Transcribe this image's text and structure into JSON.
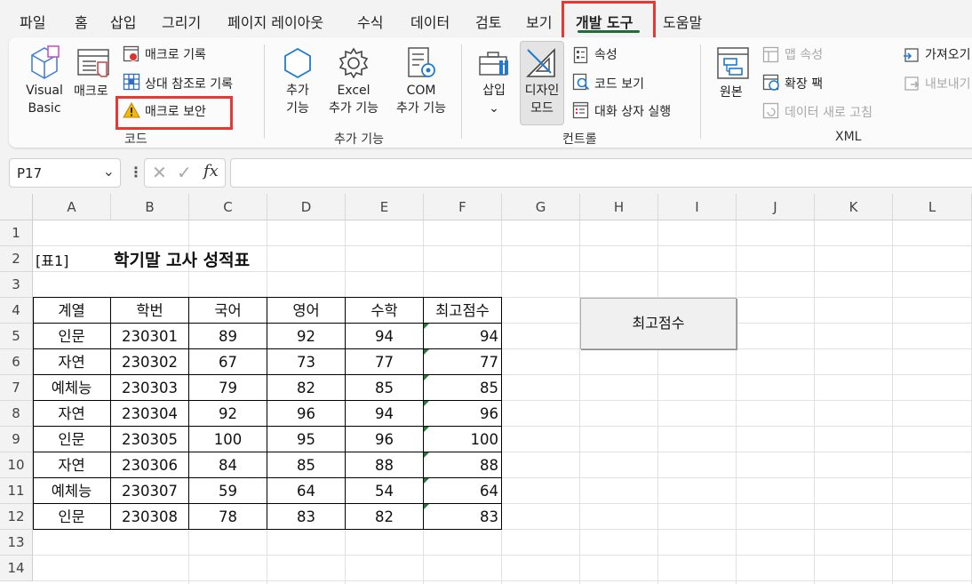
{
  "menu": [
    "파일",
    "홈",
    "삽입",
    "그리기",
    "페이지 레이아웃",
    "수식",
    "데이터",
    "검토",
    "보기",
    "개발 도구",
    "도움말"
  ],
  "menu_active_index": 9,
  "ribbon": {
    "code": {
      "visual_basic": [
        "Visual",
        "Basic"
      ],
      "macro": "매크로",
      "record_macro": "매크로 기록",
      "relative_ref": "상대 참조로 기록",
      "macro_security": "매크로 보안",
      "group_label": "코드"
    },
    "addins": {
      "addins": [
        "추가",
        "기능"
      ],
      "excel_addins": [
        "Excel",
        "추가 기능"
      ],
      "com_addins": [
        "COM",
        "추가 기능"
      ],
      "group_label": "추가 기능"
    },
    "controls": {
      "insert": "삽입",
      "design_mode": [
        "디자인",
        "모드"
      ],
      "properties": "속성",
      "view_code": "코드 보기",
      "run_dialog": "대화 상자 실행",
      "group_label": "컨트롤"
    },
    "xml": {
      "source": "원본",
      "map_properties": "맵 속성",
      "expansion_packs": "확장 팩",
      "refresh_data": "데이터 새로 고침",
      "import": "가져오기",
      "export": "내보내기",
      "group_label": "XML"
    }
  },
  "formula_bar": {
    "name_box": "P17",
    "formula": ""
  },
  "columns": [
    "A",
    "B",
    "C",
    "D",
    "E",
    "F",
    "G",
    "H",
    "I",
    "J",
    "K",
    "L"
  ],
  "rows": [
    "1",
    "2",
    "3",
    "4",
    "5",
    "6",
    "7",
    "8",
    "9",
    "10",
    "11",
    "12",
    "13",
    "14"
  ],
  "sheet": {
    "table_tag": "[표1]",
    "title": "학기말 고사 성적표",
    "headers": [
      "계열",
      "학번",
      "국어",
      "영어",
      "수학",
      "최고점수"
    ],
    "data": [
      [
        "인문",
        "230301",
        "89",
        "92",
        "94",
        "94"
      ],
      [
        "자연",
        "230302",
        "67",
        "73",
        "77",
        "77"
      ],
      [
        "예체능",
        "230303",
        "79",
        "82",
        "85",
        "85"
      ],
      [
        "자연",
        "230304",
        "92",
        "96",
        "94",
        "96"
      ],
      [
        "인문",
        "230305",
        "100",
        "95",
        "96",
        "100"
      ],
      [
        "자연",
        "230306",
        "84",
        "85",
        "88",
        "88"
      ],
      [
        "예체능",
        "230307",
        "59",
        "64",
        "54",
        "64"
      ],
      [
        "인문",
        "230308",
        "78",
        "83",
        "82",
        "83"
      ]
    ],
    "button_label": "최고점수"
  },
  "colors": {
    "accent_green": "#1e6e3a",
    "highlight_red": "#e53935",
    "error_triangle": "#1e7e34"
  },
  "icons": [
    "visual-basic-icon",
    "macro-icon",
    "record-macro-icon",
    "relative-reference-icon",
    "warning-icon",
    "addins-icon",
    "gear-icon",
    "com-addins-icon",
    "toolbox-icon",
    "design-mode-icon",
    "properties-icon",
    "view-code-icon",
    "run-dialog-icon",
    "xml-source-icon",
    "map-properties-icon",
    "expansion-pack-icon",
    "refresh-data-icon",
    "import-icon",
    "export-icon",
    "chevron-down-icon",
    "more-icon",
    "cancel-icon",
    "enter-icon",
    "function-icon"
  ]
}
